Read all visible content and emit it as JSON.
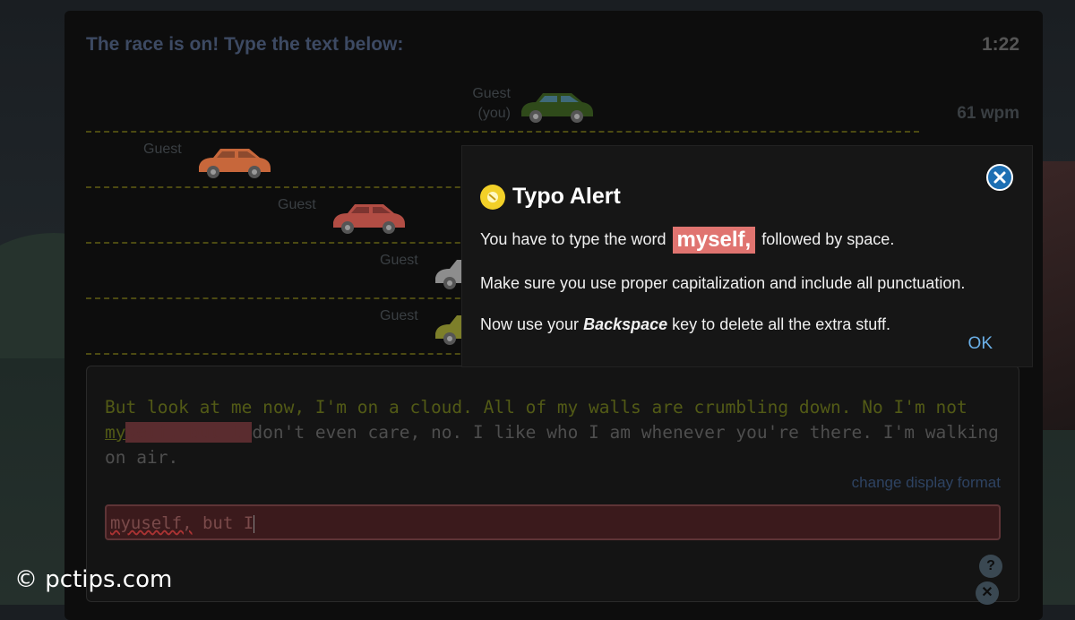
{
  "race": {
    "title": "The race is on! Type the text below:",
    "timer": "1:22",
    "wpm": "61 wpm",
    "racers": [
      {
        "name_line1": "Guest",
        "name_line2": "(you)",
        "color": "#2f4a1a"
      },
      {
        "name_line1": "Guest",
        "color": "#c7673b"
      },
      {
        "name_line1": "Guest",
        "color": "#b24d44"
      },
      {
        "name_line1": "Guest",
        "color": "#8d8d8d"
      },
      {
        "name_line1": "Guest",
        "color": "#7d7f2a"
      }
    ]
  },
  "passage": {
    "typed": "But look at me now, I'm on a cloud. All of my walls are crumbling down. No I'm not ",
    "current_word_typed": "my",
    "error_fill": "self, but I ",
    "remaining": "don't even care, no. I like who I am whenever you're there. I'm walking on air."
  },
  "display": {
    "change_format_label": "change display format"
  },
  "input": {
    "misspelled": "myuself,",
    "rest": " but I"
  },
  "modal": {
    "title": "Typo Alert",
    "line1_before": "You have to type the word",
    "word": "myself,",
    "line1_after": "followed by space.",
    "line2": "Make sure you use proper capitalization and include all punctuation.",
    "line3_before": "Now use your",
    "line3_key": "Backspace",
    "line3_after": "key to delete all the extra stuff.",
    "ok_label": "OK"
  },
  "watermark": "© pctips.com",
  "colors": {
    "accent_blue": "#1d6fb3",
    "word_highlight": "#e07470",
    "alert_yellow": "#f2d028",
    "typed_green": "#525a16",
    "error_red": "#5a2c2f"
  },
  "icons": [
    "close-icon",
    "typo-alert-icon",
    "help-icon",
    "close-icon"
  ]
}
